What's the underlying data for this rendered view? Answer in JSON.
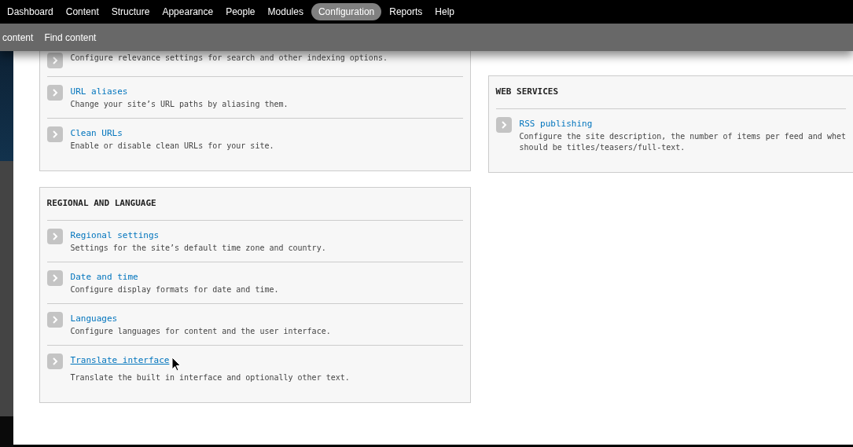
{
  "toolbar": {
    "menu": [
      {
        "label": "Dashboard",
        "selected": false
      },
      {
        "label": "Content",
        "selected": false
      },
      {
        "label": "Structure",
        "selected": false
      },
      {
        "label": "Appearance",
        "selected": false
      },
      {
        "label": "People",
        "selected": false
      },
      {
        "label": "Modules",
        "selected": false
      },
      {
        "label": "Configuration",
        "selected": true
      },
      {
        "label": "Reports",
        "selected": false
      },
      {
        "label": "Help",
        "selected": false
      }
    ]
  },
  "shortcuts": [
    "content",
    "Find content"
  ],
  "left_column": [
    {
      "items": [
        {
          "description": [
            "Configure relevance settings for search and other indexing options."
          ]
        },
        {
          "title": "URL aliases",
          "description": [
            "Change your site’s URL paths by aliasing them."
          ],
          "hovered": false
        },
        {
          "title": "Clean URLs",
          "description": [
            "Enable or disable clean URLs for your site."
          ],
          "hovered": false
        }
      ]
    },
    {
      "title": "REGIONAL AND LANGUAGE",
      "items": [
        {
          "title": "Regional settings",
          "description": [
            "Settings for the site’s default time zone and country."
          ],
          "hovered": false
        },
        {
          "title": "Date and time",
          "description": [
            "Configure display formats for date and time."
          ],
          "hovered": false
        },
        {
          "title": "Languages",
          "description": [
            "Configure languages for content and the user interface."
          ],
          "hovered": false
        },
        {
          "title": "Translate interface",
          "description": [
            "Translate the built in interface and optionally other text."
          ],
          "hovered": true
        }
      ]
    }
  ],
  "right_column": [
    {
      "title": "WEB SERVICES",
      "items": [
        {
          "title": "RSS publishing",
          "description": [
            "Configure the site description, the number of items per feed and whet",
            "should be titles/teasers/full-text."
          ],
          "hovered": false
        }
      ]
    }
  ]
}
